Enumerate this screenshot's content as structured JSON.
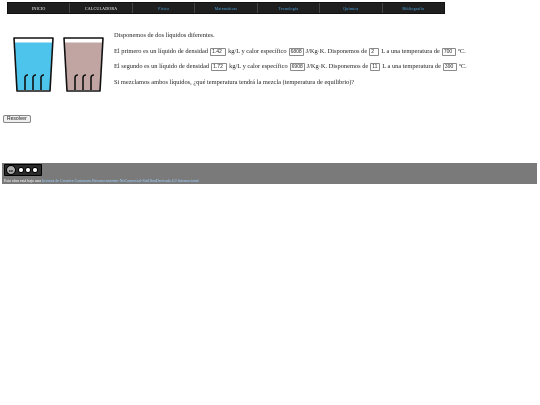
{
  "nav": [
    {
      "label": "INICIO",
      "link": false
    },
    {
      "label": "CALCULADORA",
      "link": false
    },
    {
      "label": "Física",
      "link": true
    },
    {
      "label": "Matemáticas",
      "link": true
    },
    {
      "label": "Tecnología",
      "link": true
    },
    {
      "label": "Química",
      "link": true
    },
    {
      "label": "Bibliografía",
      "link": true
    }
  ],
  "liquids": [
    {
      "color": "#4cc4ec"
    },
    {
      "color": "#c1a5a3"
    }
  ],
  "problem": {
    "intro": "Disponemos de dos líquidos diferentes.",
    "line1": {
      "a": "El primero es un líquido de densidad",
      "density": "1.42",
      "b": "kg/L y calor específico",
      "heat": "6808",
      "c": "J/Kg·K. Disponemos de",
      "volume": "2",
      "d": "L a una temperatura de",
      "temp": "700",
      "e": "ºC."
    },
    "line2": {
      "a": "El segundo es un líquido de densidad",
      "density": "1.72",
      "b": "kg/L y calor específico",
      "heat": "6908",
      "c": "J/Kg·K. Disponemos de",
      "volume": "11",
      "d": "L a una temperatura de",
      "temp": "390",
      "e": "ºC."
    },
    "question": "Si mezclamos ambos líquidos, ¿qué temperatura tendrá la mezcla (temperatura de equilibrio)?"
  },
  "resolver_label": "Resolver",
  "footer": {
    "badge_text": "cc",
    "license_prefix": "Esta obra está bajo una",
    "license_link": "licencia de Creative Commons Reconocimiento-NoComercial-SinObraDerivada 4.0 Internacional"
  }
}
